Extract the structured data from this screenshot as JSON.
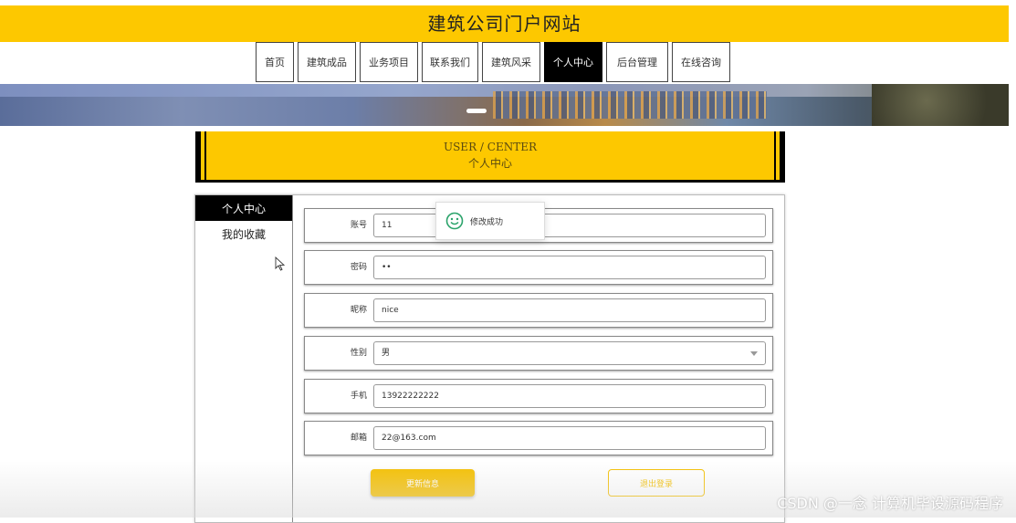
{
  "site": {
    "title": "建筑公司门户网站"
  },
  "nav": {
    "items": [
      {
        "label": "首页"
      },
      {
        "label": "建筑成品"
      },
      {
        "label": "业务项目"
      },
      {
        "label": "联系我们"
      },
      {
        "label": "建筑风采"
      },
      {
        "label": "个人中心"
      },
      {
        "label": "后台管理"
      },
      {
        "label": "在线咨询"
      }
    ],
    "active": "个人中心"
  },
  "section_header": {
    "en": "USER / CENTER",
    "cn": "个人中心"
  },
  "side_menu": {
    "items": [
      {
        "label": "个人中心"
      },
      {
        "label": "我的收藏"
      }
    ]
  },
  "form": {
    "account": {
      "label": "账号",
      "value": "11"
    },
    "password": {
      "label": "密码",
      "value": "••"
    },
    "nickname": {
      "label": "昵称",
      "value": "nice"
    },
    "gender": {
      "label": "性别",
      "value": "男"
    },
    "phone": {
      "label": "手机",
      "value": "13922222222"
    },
    "email": {
      "label": "邮箱",
      "value": "22@163.com"
    }
  },
  "buttons": {
    "update": "更新信息",
    "logout": "退出登录"
  },
  "toast": {
    "message": "修改成功"
  },
  "watermark": "CSDN @一念 计算机毕设源码程序",
  "colors": {
    "accent": "#fdc800",
    "button": "#f5c000",
    "active_nav": "#000000"
  }
}
